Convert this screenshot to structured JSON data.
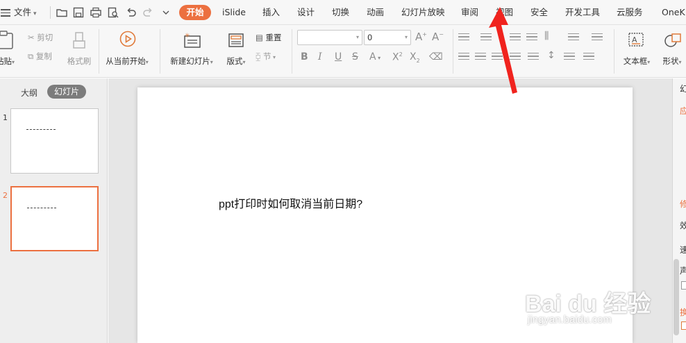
{
  "menu": {
    "file_label": "文件",
    "tabs": [
      "开始",
      "iSlide",
      "插入",
      "设计",
      "切换",
      "动画",
      "幻灯片放映",
      "审阅",
      "视图",
      "安全",
      "开发工具",
      "云服务",
      "OneK"
    ],
    "active_tab": "开始",
    "accent_color": "#ec7040"
  },
  "ribbon": {
    "paste_label": "粘贴",
    "cut_label": "剪切",
    "copy_label": "复制",
    "format_painter_label": "格式刷",
    "play_from_current_label": "从当前开始",
    "new_slide_label": "新建幻灯片",
    "layout_label": "版式",
    "reset_label": "重置",
    "section_label": "节",
    "font_name_value": "",
    "font_size_value": "0",
    "textbox_label": "文本框",
    "shape_label": "形状"
  },
  "left_panel": {
    "outline_tab": "大纲",
    "slides_tab": "幻灯片",
    "slides": [
      {
        "number": "1",
        "selected": false
      },
      {
        "number": "2",
        "selected": true
      }
    ]
  },
  "slide": {
    "text": "ppt打印时如何取消当前日期?"
  },
  "right_panel": {
    "title_partial": "幻",
    "section1_partial": "应",
    "section2_partial": "修",
    "row1_partial": "效",
    "row2_partial": "速",
    "row3_partial": "声",
    "row4_partial": "换"
  },
  "watermark": {
    "logo_text": "Bai du 经验",
    "url_text": "jingyan.baidu.com"
  }
}
